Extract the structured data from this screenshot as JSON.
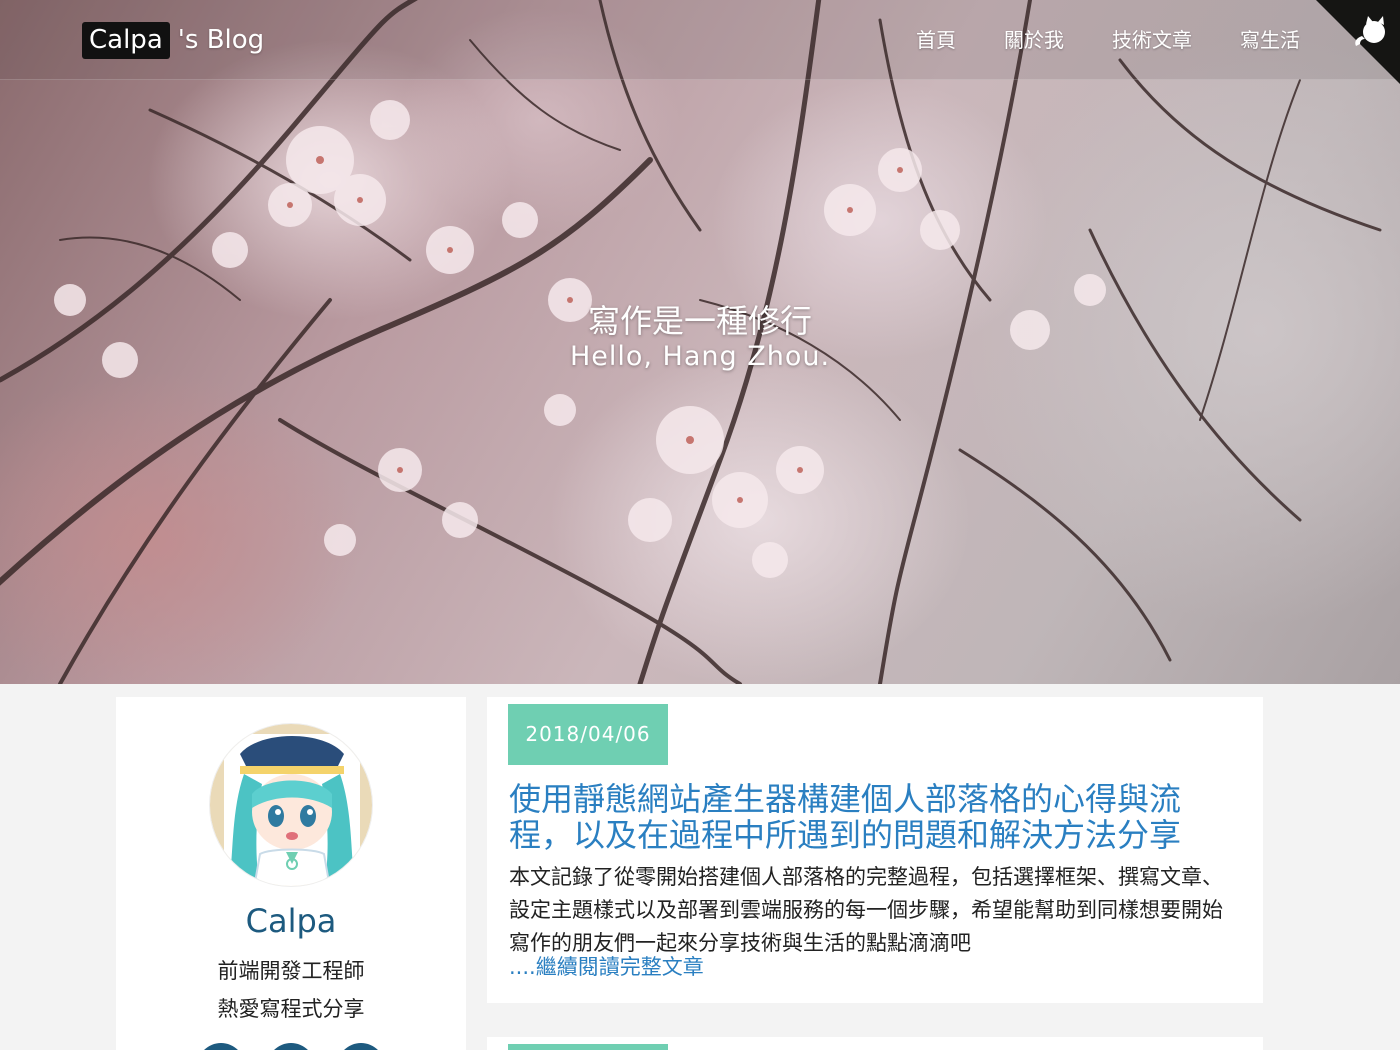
{
  "site": {
    "brand_box": "Calpa",
    "brand_rest": "'s Blog"
  },
  "nav": {
    "items": [
      "首頁",
      "關於我",
      "技術文章",
      "寫生活"
    ]
  },
  "hero": {
    "title": "寫作是一種修行",
    "subtitle": "Hello, Hang Zhou."
  },
  "profile": {
    "name": "Calpa",
    "line1": "前端開發工程師",
    "line2": "熱愛寫程式分享"
  },
  "posts": [
    {
      "date": "2018/04/06",
      "title": "使用靜態網站產生器構建個人部落格的心得與流程，以及在過程中所遇到的問題和解決方法分享",
      "excerpt": "本文記錄了從零開始搭建個人部落格的完整過程，包括選擇框架、撰寫文章、設定主題樣式以及部署到雲端服務的每一個步驟，希望能幫助到同樣想要開始寫作的朋友們一起來分享技術與生活的點點滴滴吧",
      "more_prefix": "....",
      "more_label": "繼續閱讀完整文章"
    },
    {
      "date": ""
    }
  ],
  "colors": {
    "accent": "#2a7fc1",
    "badge": "#6fcfb2",
    "name": "#1d5a7f"
  }
}
